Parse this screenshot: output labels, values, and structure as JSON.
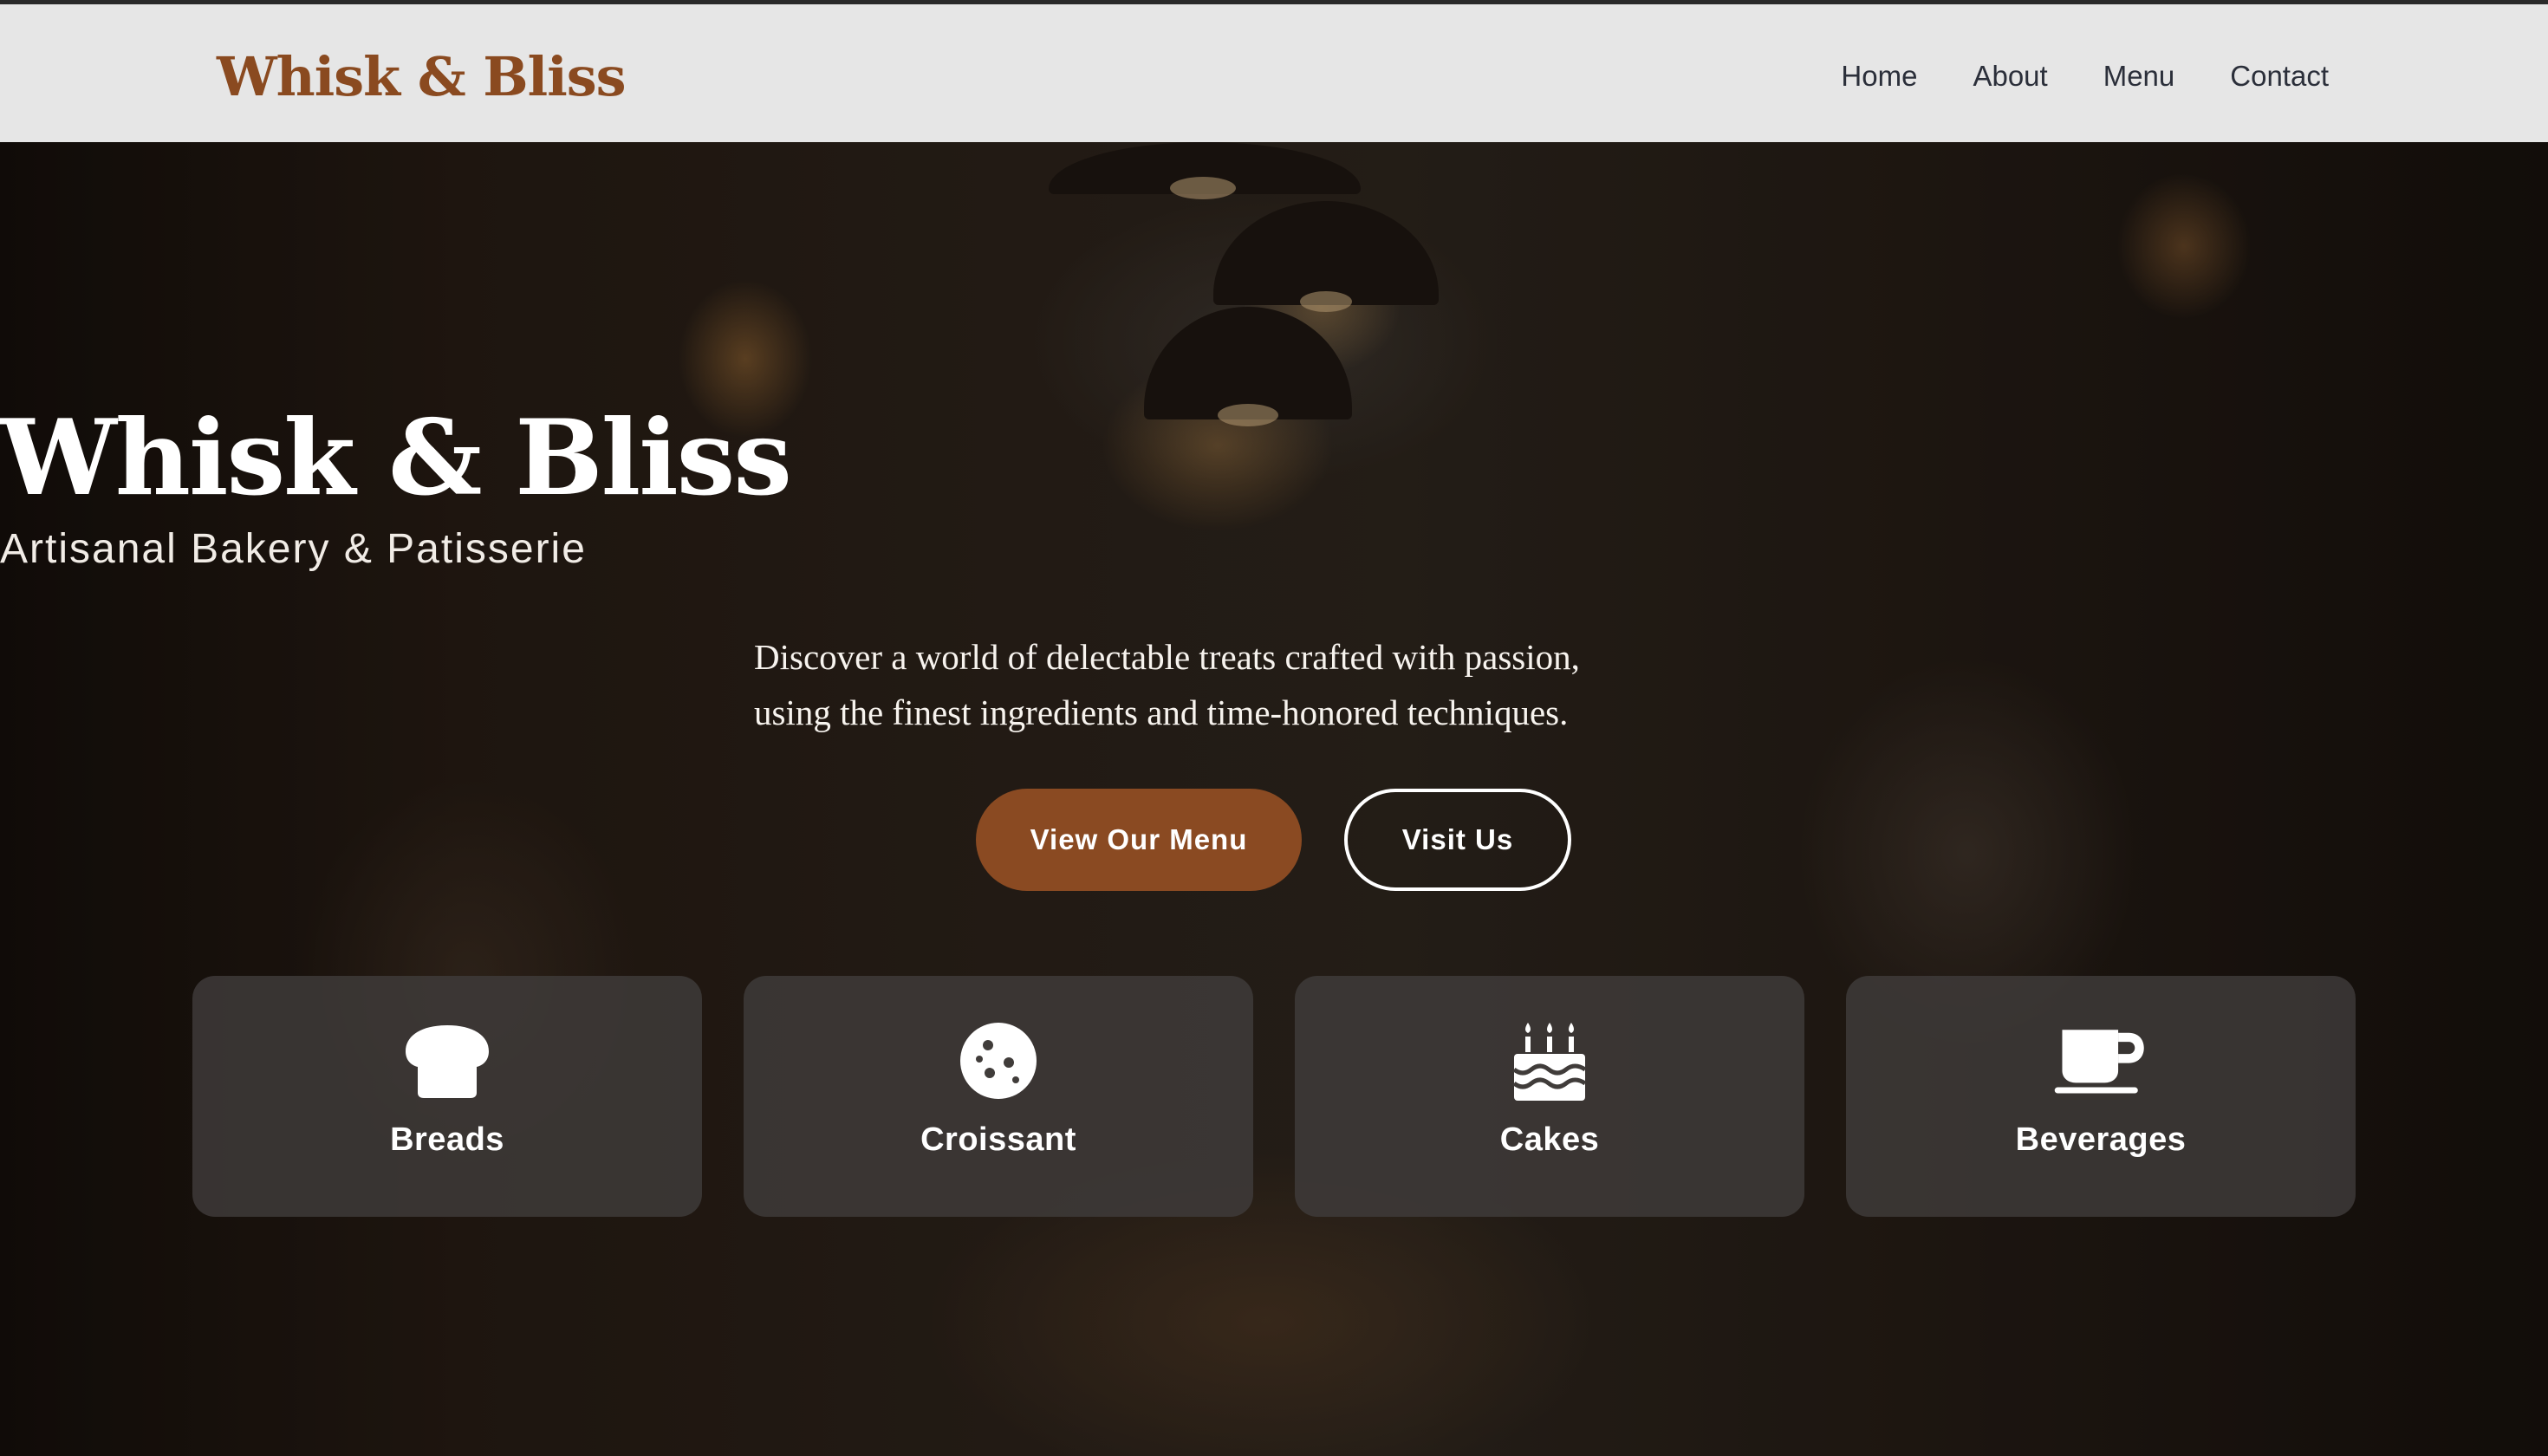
{
  "nav": {
    "brand": "Whisk & Bliss",
    "links": [
      {
        "label": "Home"
      },
      {
        "label": "About"
      },
      {
        "label": "Menu"
      },
      {
        "label": "Contact"
      }
    ]
  },
  "hero": {
    "title": "Whisk & Bliss",
    "subtitle": "Artisanal Bakery & Patisserie",
    "description_line1": "Discover a world of delectable treats crafted with passion,",
    "description_line2": "using the finest ingredients and time-honored techniques.",
    "primary_button": "View Our Menu",
    "secondary_button": "Visit Us"
  },
  "categories": [
    {
      "label": "Breads",
      "icon": "bread-icon"
    },
    {
      "label": "Croissant",
      "icon": "cookie-icon"
    },
    {
      "label": "Cakes",
      "icon": "birthday-cake-icon"
    },
    {
      "label": "Beverages",
      "icon": "coffee-cup-icon"
    }
  ],
  "colors": {
    "brand": "#8a4a20",
    "primary_button": "#8a4a22",
    "nav_background": "#e6e6e6",
    "nav_text": "#2b2f3a",
    "card_background": "#403c3a"
  }
}
